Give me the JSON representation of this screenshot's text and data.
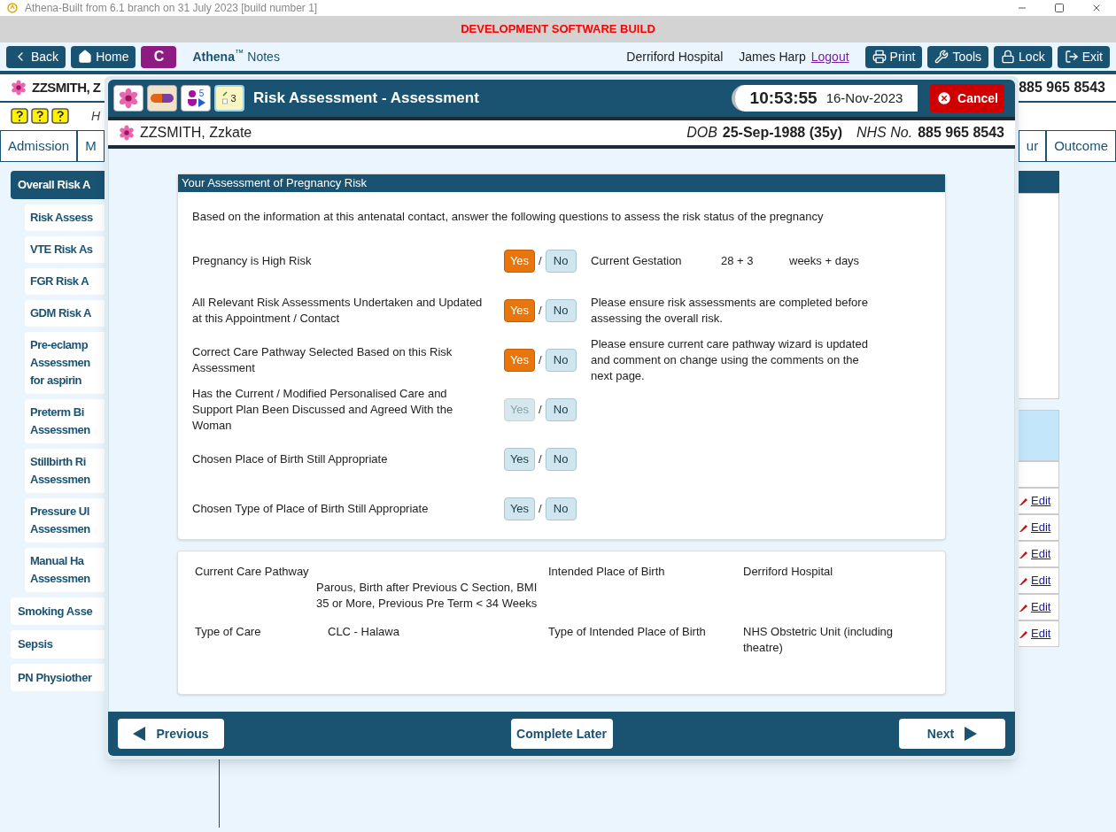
{
  "window": {
    "title": "Athena-Built from 6.1 branch on 31 July 2023 [build number 1]"
  },
  "banner": "DEVELOPMENT SOFTWARE BUILD",
  "toolbar": {
    "left": [
      {
        "kind": "back",
        "label": "Back"
      },
      {
        "kind": "home",
        "label": "Home"
      },
      {
        "kind": "letter",
        "label": "C"
      }
    ],
    "brand": "Athena",
    "brand_mark": "™",
    "app": "Notes",
    "site": "Derriford Hospital",
    "user": "James Harp",
    "logout": "Logout",
    "right": [
      {
        "kind": "print",
        "label": "Print"
      },
      {
        "kind": "tools",
        "label": "Tools"
      },
      {
        "kind": "lock",
        "label": "Lock"
      },
      {
        "kind": "exit",
        "label": "Exit"
      }
    ]
  },
  "patient_bar": {
    "name": "ZZSMITH, Z",
    "nhs": "885 965 8543"
  },
  "info_row": {
    "text": "H"
  },
  "tabs": [
    {
      "label": "Admission",
      "selected": false
    },
    {
      "label": "M",
      "selected": false
    },
    {
      "label": "ur",
      "selected": false
    },
    {
      "label": "Outcome",
      "selected": false
    }
  ],
  "sidebar": {
    "items": [
      {
        "label": "Overall Risk A",
        "selected": true,
        "children": [
          {
            "label": "Risk Assess",
            "selected": false
          },
          {
            "label": "VTE Risk As",
            "selected": false
          },
          {
            "label": "FGR Risk A",
            "selected": false
          },
          {
            "label": "GDM Risk A",
            "selected": false
          },
          {
            "label": "Pre-eclamp\nAssessmen\nfor aspirin",
            "selected": false
          },
          {
            "label": "Preterm Bi\nAssessmen",
            "selected": false
          },
          {
            "label": "Stillbirth Ri\nAssessmen",
            "selected": false
          },
          {
            "label": "Pressure Ul\nAssessmen",
            "selected": false
          },
          {
            "label": "Manual Ha\nAssessmen",
            "selected": false
          }
        ]
      },
      {
        "label": "Smoking Asse",
        "selected": false
      },
      {
        "label": "Sepsis",
        "selected": false
      },
      {
        "label": "PN Physiother",
        "selected": false
      }
    ]
  },
  "edit_links": [
    "Edit",
    "Edit",
    "Edit",
    "Edit",
    "Edit",
    "Edit"
  ],
  "dialog": {
    "title": "Risk Assessment - Assessment",
    "icon_badges": [
      "5",
      "3"
    ],
    "time": "10:53:55",
    "date": "16-Nov-2023",
    "cancel": "Cancel",
    "patient": {
      "name": "ZZSMITH, Zzkate",
      "dob_label": "DOB",
      "dob": "25-Sep-1988 (35y)",
      "nhs_label": "NHS No.",
      "nhs": "885 965 8543"
    },
    "section": {
      "title": "Your Assessment of Pregnancy Risk",
      "intro": "Based on the information at this antenatal contact, answer the following questions to assess the risk status of the pregnancy",
      "questions": [
        {
          "label": "Pregnancy is High Risk",
          "yes": "Yes",
          "sep": "/",
          "no": "No",
          "yes_selected": true,
          "no_selected": false,
          "yes_disabled": false,
          "kind": "gestation",
          "note_label": "Current Gestation",
          "note_value": "28 + 3",
          "note_unit": "weeks + days"
        },
        {
          "label": "All Relevant Risk Assessments Undertaken and Updated at this Appointment / Contact",
          "yes": "Yes",
          "sep": "/",
          "no": "No",
          "yes_selected": true,
          "no_selected": false,
          "yes_disabled": false,
          "kind": "note",
          "note": "Please ensure risk assessments are completed before assessing the overall risk."
        },
        {
          "label": "Correct Care Pathway Selected Based on this Risk Assessment",
          "yes": "Yes",
          "sep": "/",
          "no": "No",
          "yes_selected": true,
          "no_selected": false,
          "yes_disabled": false,
          "kind": "note",
          "note": "Please ensure current care pathway wizard is updated and comment on change using the comments on the next page."
        },
        {
          "label": "Has the Current / Modified Personalised Care and Support Plan Been Discussed and Agreed With the Woman",
          "yes": "Yes",
          "sep": "/",
          "no": "No",
          "yes_selected": false,
          "no_selected": false,
          "yes_disabled": true,
          "kind": "plain"
        },
        {
          "label": "Chosen Place of Birth Still Appropriate",
          "yes": "Yes",
          "sep": "/",
          "no": "No",
          "yes_selected": false,
          "no_selected": false,
          "yes_disabled": false,
          "kind": "plain"
        },
        {
          "label": "Chosen Type of Place of Birth Still Appropriate",
          "yes": "Yes",
          "sep": "/",
          "no": "No",
          "yes_selected": false,
          "no_selected": false,
          "yes_disabled": false,
          "kind": "plain"
        }
      ]
    },
    "summary": [
      {
        "label": "Current Care Pathway",
        "value": "Parous, Birth after Previous C Section, BMI 35 or More, Previous Pre Term < 34 Weeks",
        "label2": "Intended Place of Birth",
        "value2": "Derriford Hospital"
      },
      {
        "label": "Type of Care",
        "value": "CLC - Halawa",
        "label2": "Type of  Intended Place of Birth",
        "value2": "NHS Obstetric Unit (including theatre)"
      }
    ],
    "footer": {
      "previous": "Previous",
      "later": "Complete Later",
      "next": "Next"
    }
  }
}
